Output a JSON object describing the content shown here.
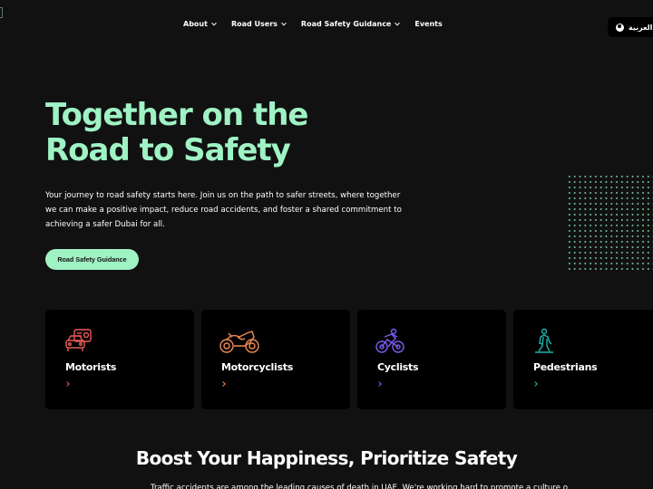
{
  "header": {
    "nav": [
      {
        "label": "About",
        "has_dropdown": true
      },
      {
        "label": "Road Users",
        "has_dropdown": true
      },
      {
        "label": "Road Safety Guidance",
        "has_dropdown": true
      },
      {
        "label": "Events",
        "has_dropdown": false
      }
    ],
    "language_button": {
      "label": "العربية",
      "icon": "globe-icon"
    }
  },
  "hero": {
    "title_line1": "Together on the",
    "title_line2": "Road to Safety",
    "description": "Your journey to road safety starts here. Join us on the path to safer streets, where together we can make a positive impact, reduce road accidents, and foster a shared commitment to achieving a safer Dubai for all.",
    "cta_label": "Road Safety Guidance",
    "accent_color": "#9ff2c4"
  },
  "road_users": [
    {
      "label": "Motorists",
      "icon": "car-license-icon",
      "color": "#e85a5a"
    },
    {
      "label": "Motorcyclists",
      "icon": "motorcycle-icon",
      "color": "#f08a55"
    },
    {
      "label": "Cyclists",
      "icon": "cyclist-icon",
      "color": "#7b5cf0"
    },
    {
      "label": "Pedestrians",
      "icon": "pedestrian-icon",
      "color": "#1fb5ac"
    }
  ],
  "happiness_section": {
    "title": "Boost Your Happiness, Prioritize Safety",
    "text": "Traffic accidents are among the leading causes of death in UAE. We're working hard to promote a culture of"
  }
}
